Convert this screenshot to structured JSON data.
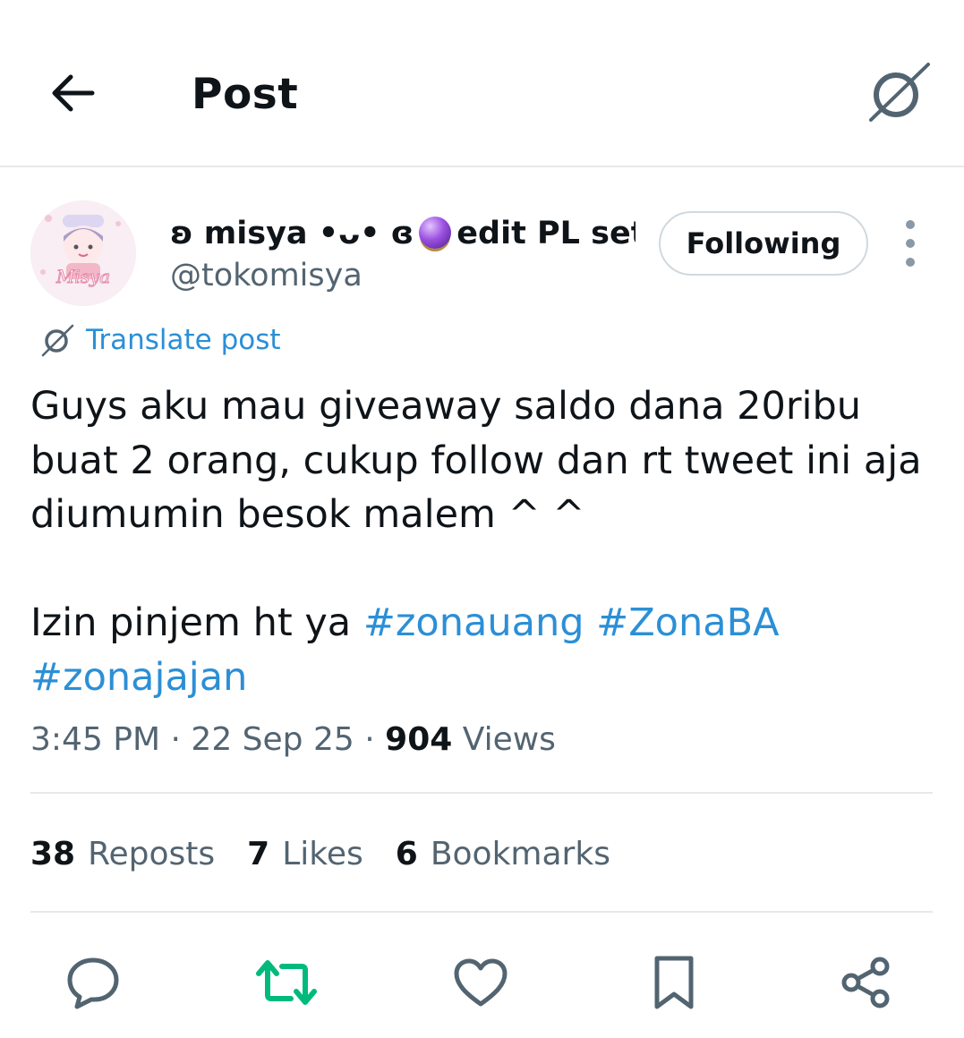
{
  "header": {
    "title": "Post",
    "back_icon": "arrow-left-icon",
    "translate_icon": "grok-translate-icon"
  },
  "author": {
    "display_name_part1": "ʚ misya •ᴗ• ɞ",
    "display_name_part2": "edit PL set...",
    "handle": "@tokomisya",
    "avatar_text": "Misya",
    "emoji_icon": "crystal-ball-icon",
    "follow_label": "Following"
  },
  "translate": {
    "label": "Translate post"
  },
  "tweet": {
    "line1": "Guys aku mau giveaway saldo dana 20ribu buat 2 orang, cukup follow dan rt tweet ini aja diumumin besok malem ^ ^",
    "line2_prefix": "Izin pinjem ht ya ",
    "hashtags": [
      "#zonauang",
      "#ZonaBA",
      "#zonajajan"
    ]
  },
  "meta": {
    "time": "3:45 PM",
    "separator": "·",
    "date": "22 Sep 25",
    "views_count": "904",
    "views_label": "Views"
  },
  "stats": {
    "reposts_count": "38",
    "reposts_label": "Reposts",
    "likes_count": "7",
    "likes_label": "Likes",
    "bookmarks_count": "6",
    "bookmarks_label": "Bookmarks"
  },
  "colors": {
    "link": "#2b8fd6",
    "secondary_text": "#536471",
    "repost_active": "#00ba7c",
    "icon_gray": "#536471"
  },
  "actions": [
    "reply-icon",
    "repost-icon",
    "like-icon",
    "bookmark-icon",
    "share-icon"
  ]
}
